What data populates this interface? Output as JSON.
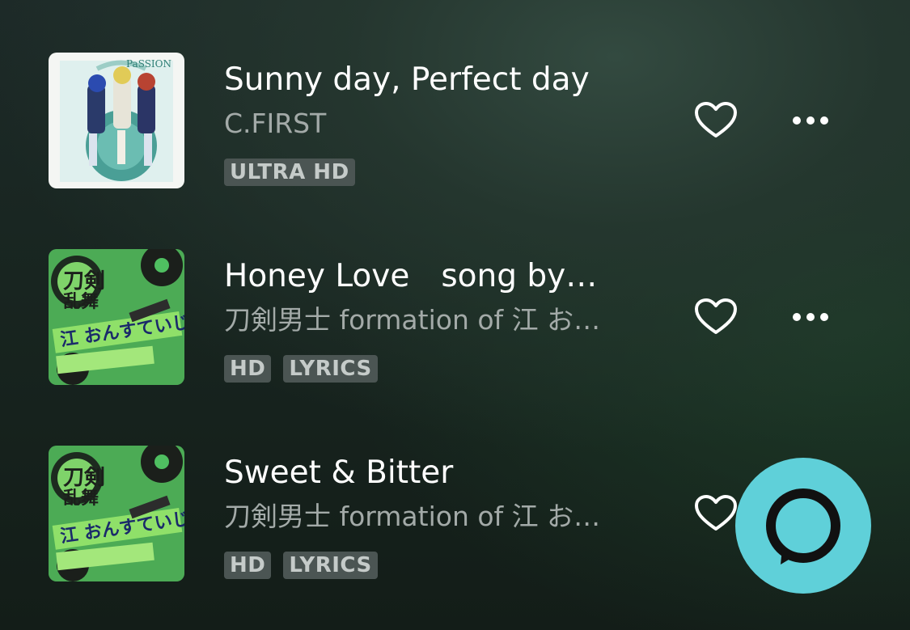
{
  "tracks": [
    {
      "title": "Sunny day, Perfect day",
      "artist": "C.FIRST",
      "badges": [
        "ULTRA HD"
      ],
      "art_icon": "album-art-cfirst-passion",
      "heart_icon": "heart-outline-icon",
      "more_icon": "more-horizontal-icon"
    },
    {
      "title": "Honey Love　song by…",
      "artist": "刀剣男士 formation of 江 お…",
      "badges": [
        "HD",
        "LYRICS"
      ],
      "art_icon": "album-art-touken-ranbu",
      "heart_icon": "heart-outline-icon",
      "more_icon": "more-horizontal-icon"
    },
    {
      "title": "Sweet & Bitter",
      "artist": "刀剣男士 formation of 江 お…",
      "badges": [
        "HD",
        "LYRICS"
      ],
      "art_icon": "album-art-touken-ranbu",
      "heart_icon": "heart-outline-icon"
    }
  ],
  "alexa_button": {
    "icon": "alexa-ring-icon",
    "color": "#5fd0d9"
  },
  "colors": {
    "title": "#ffffff",
    "artist": "#a3aaa8",
    "badge_bg": "#4b5553",
    "badge_text": "#c5cbc9"
  }
}
